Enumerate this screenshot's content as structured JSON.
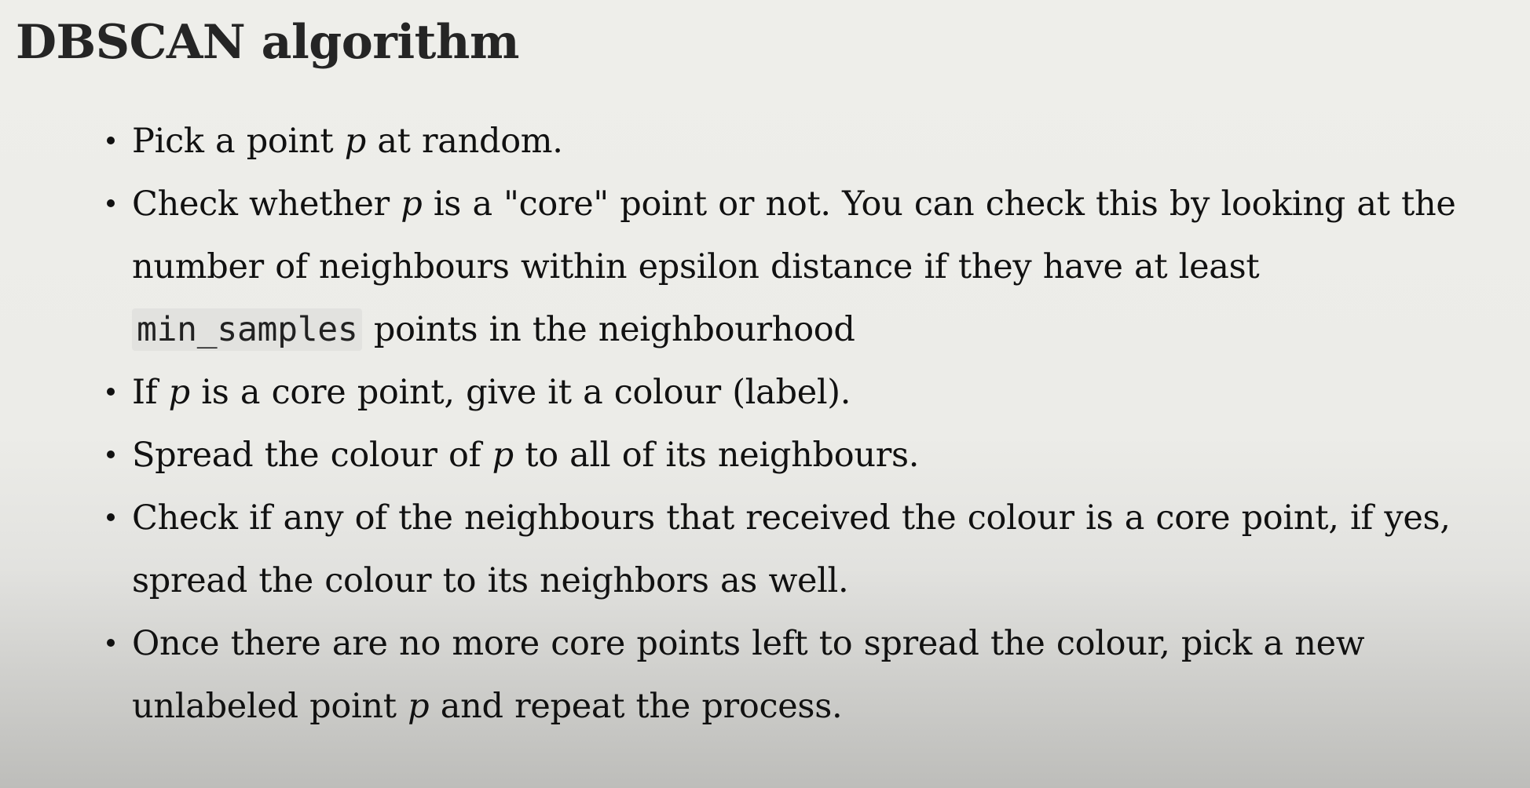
{
  "title": "DBSCAN algorithm",
  "bullets": [
    {
      "before": "Pick a point ",
      "var": "p",
      "after": " at random."
    },
    {
      "before": "Check whether ",
      "var": "p",
      "middle": " is a \"core\" point or not. You can check this by looking at the number of neighbours within epsilon distance if they have at least ",
      "code": "min_samples",
      "after": " points in the neighbourhood"
    },
    {
      "before": "If ",
      "var": "p",
      "after": " is a core point, give it a colour (label)."
    },
    {
      "before": "Spread the colour of ",
      "var": "p",
      "after": " to all of its neighbours."
    },
    {
      "text": "Check if any of the neighbours that received the colour is a core point, if yes, spread the colour to its neighbors as well."
    },
    {
      "before": "Once there are no more core points left to spread the colour, pick a new unlabeled point ",
      "var": "p",
      "after": " and repeat the process."
    }
  ]
}
